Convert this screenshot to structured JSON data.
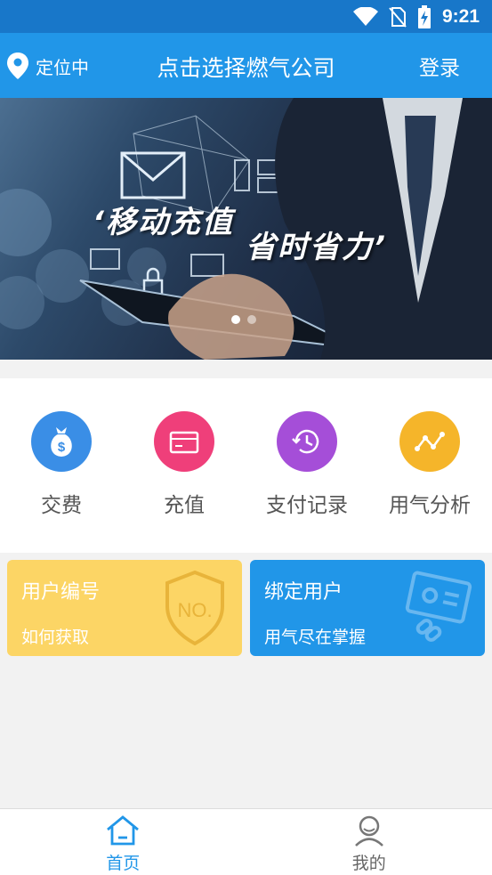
{
  "status_bar": {
    "time": "9:21",
    "icons": [
      "wifi-icon",
      "no-sim-icon",
      "battery-charging-icon"
    ]
  },
  "header": {
    "location_label": "定位中",
    "title": "点击选择燃气公司",
    "login_label": "登录"
  },
  "banner": {
    "text_left": "‘移动充值",
    "text_right": "省时省力’",
    "slide_count": 2,
    "active_slide": 1
  },
  "menu": {
    "items": [
      {
        "label": "交费",
        "icon": "money-bag-icon",
        "color": "#3a8ee6"
      },
      {
        "label": "充值",
        "icon": "card-icon",
        "color": "#ef3f7a"
      },
      {
        "label": "支付记录",
        "icon": "history-icon",
        "color": "#a54ed8"
      },
      {
        "label": "用气分析",
        "icon": "trend-icon",
        "color": "#f5b52a"
      }
    ]
  },
  "cards": {
    "user_no": {
      "title": "用户编号",
      "subtitle": "如何获取",
      "badge_text": "NO.",
      "color": "#fcd565"
    },
    "bind": {
      "title": "绑定用户",
      "subtitle": "用气尽在掌握",
      "color": "#2196e8"
    }
  },
  "bottom_nav": {
    "home_label": "首页",
    "mine_label": "我的",
    "active_color": "#2196e8"
  }
}
